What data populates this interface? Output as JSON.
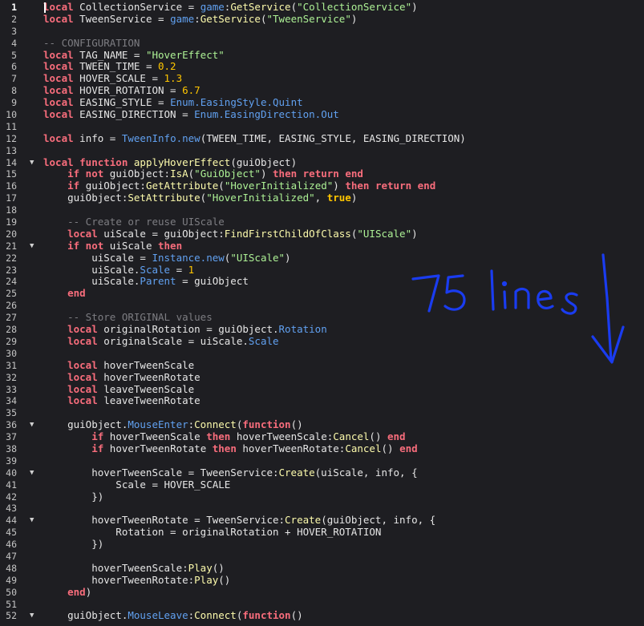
{
  "editor": {
    "cursor_line": 1,
    "lines": [
      {
        "n": "1",
        "fold": false,
        "tokens": [
          {
            "t": "local",
            "c": "kw"
          },
          {
            "t": " CollectionService = ",
            "c": "id"
          },
          {
            "t": "game",
            "c": "prop"
          },
          {
            "t": ":",
            "c": "id"
          },
          {
            "t": "GetService",
            "c": "fn"
          },
          {
            "t": "(",
            "c": "id"
          },
          {
            "t": "\"CollectionService\"",
            "c": "str"
          },
          {
            "t": ")",
            "c": "id"
          }
        ]
      },
      {
        "n": "2",
        "fold": false,
        "tokens": [
          {
            "t": "local",
            "c": "kw"
          },
          {
            "t": " TweenService = ",
            "c": "id"
          },
          {
            "t": "game",
            "c": "prop"
          },
          {
            "t": ":",
            "c": "id"
          },
          {
            "t": "GetService",
            "c": "fn"
          },
          {
            "t": "(",
            "c": "id"
          },
          {
            "t": "\"TweenService\"",
            "c": "str"
          },
          {
            "t": ")",
            "c": "id"
          }
        ]
      },
      {
        "n": "3",
        "fold": false,
        "tokens": []
      },
      {
        "n": "4",
        "fold": false,
        "tokens": [
          {
            "t": "-- CONFIGURATION",
            "c": "cmt"
          }
        ]
      },
      {
        "n": "5",
        "fold": false,
        "tokens": [
          {
            "t": "local",
            "c": "kw"
          },
          {
            "t": " TAG_NAME = ",
            "c": "id"
          },
          {
            "t": "\"HoverEffect\"",
            "c": "str"
          }
        ]
      },
      {
        "n": "6",
        "fold": false,
        "tokens": [
          {
            "t": "local",
            "c": "kw"
          },
          {
            "t": " TWEEN_TIME = ",
            "c": "id"
          },
          {
            "t": "0.2",
            "c": "num"
          }
        ]
      },
      {
        "n": "7",
        "fold": false,
        "tokens": [
          {
            "t": "local",
            "c": "kw"
          },
          {
            "t": " HOVER_SCALE = ",
            "c": "id"
          },
          {
            "t": "1.3",
            "c": "num"
          }
        ]
      },
      {
        "n": "8",
        "fold": false,
        "tokens": [
          {
            "t": "local",
            "c": "kw"
          },
          {
            "t": " HOVER_ROTATION = ",
            "c": "id"
          },
          {
            "t": "6.7",
            "c": "num"
          }
        ]
      },
      {
        "n": "9",
        "fold": false,
        "tokens": [
          {
            "t": "local",
            "c": "kw"
          },
          {
            "t": " EASING_STYLE = ",
            "c": "id"
          },
          {
            "t": "Enum.EasingStyle.Quint",
            "c": "prop"
          }
        ]
      },
      {
        "n": "10",
        "fold": false,
        "tokens": [
          {
            "t": "local",
            "c": "kw"
          },
          {
            "t": " EASING_DIRECTION = ",
            "c": "id"
          },
          {
            "t": "Enum.EasingDirection.Out",
            "c": "prop"
          }
        ]
      },
      {
        "n": "11",
        "fold": false,
        "tokens": []
      },
      {
        "n": "12",
        "fold": false,
        "tokens": [
          {
            "t": "local",
            "c": "kw"
          },
          {
            "t": " info = ",
            "c": "id"
          },
          {
            "t": "TweenInfo.new",
            "c": "prop"
          },
          {
            "t": "(TWEEN_TIME, EASING_STYLE, EASING_DIRECTION)",
            "c": "id"
          }
        ]
      },
      {
        "n": "13",
        "fold": false,
        "tokens": []
      },
      {
        "n": "14",
        "fold": true,
        "tokens": [
          {
            "t": "local function",
            "c": "kw"
          },
          {
            "t": " ",
            "c": "id"
          },
          {
            "t": "applyHoverEffect",
            "c": "fn"
          },
          {
            "t": "(guiObject)",
            "c": "id"
          }
        ]
      },
      {
        "n": "15",
        "fold": false,
        "tokens": [
          {
            "t": "    ",
            "c": "id"
          },
          {
            "t": "if not",
            "c": "kw"
          },
          {
            "t": " guiObject:",
            "c": "id"
          },
          {
            "t": "IsA",
            "c": "fn"
          },
          {
            "t": "(",
            "c": "id"
          },
          {
            "t": "\"GuiObject\"",
            "c": "str"
          },
          {
            "t": ") ",
            "c": "id"
          },
          {
            "t": "then return end",
            "c": "kw"
          }
        ]
      },
      {
        "n": "16",
        "fold": false,
        "tokens": [
          {
            "t": "    ",
            "c": "id"
          },
          {
            "t": "if",
            "c": "kw"
          },
          {
            "t": " guiObject:",
            "c": "id"
          },
          {
            "t": "GetAttribute",
            "c": "fn"
          },
          {
            "t": "(",
            "c": "id"
          },
          {
            "t": "\"HoverInitialized\"",
            "c": "str"
          },
          {
            "t": ") ",
            "c": "id"
          },
          {
            "t": "then return end",
            "c": "kw"
          }
        ]
      },
      {
        "n": "17",
        "fold": false,
        "tokens": [
          {
            "t": "    guiObject:",
            "c": "id"
          },
          {
            "t": "SetAttribute",
            "c": "fn"
          },
          {
            "t": "(",
            "c": "id"
          },
          {
            "t": "\"HoverInitialized\"",
            "c": "str"
          },
          {
            "t": ", ",
            "c": "id"
          },
          {
            "t": "true",
            "c": "bool"
          },
          {
            "t": ")",
            "c": "id"
          }
        ]
      },
      {
        "n": "18",
        "fold": false,
        "tokens": []
      },
      {
        "n": "19",
        "fold": false,
        "tokens": [
          {
            "t": "    ",
            "c": "id"
          },
          {
            "t": "-- Create or reuse UIScale",
            "c": "cmt"
          }
        ]
      },
      {
        "n": "20",
        "fold": false,
        "tokens": [
          {
            "t": "    ",
            "c": "id"
          },
          {
            "t": "local",
            "c": "kw"
          },
          {
            "t": " uiScale = guiObject:",
            "c": "id"
          },
          {
            "t": "FindFirstChildOfClass",
            "c": "fn"
          },
          {
            "t": "(",
            "c": "id"
          },
          {
            "t": "\"UIScale\"",
            "c": "str"
          },
          {
            "t": ")",
            "c": "id"
          }
        ]
      },
      {
        "n": "21",
        "fold": true,
        "tokens": [
          {
            "t": "    ",
            "c": "id"
          },
          {
            "t": "if not",
            "c": "kw"
          },
          {
            "t": " uiScale ",
            "c": "id"
          },
          {
            "t": "then",
            "c": "kw"
          }
        ]
      },
      {
        "n": "22",
        "fold": false,
        "tokens": [
          {
            "t": "        uiScale = ",
            "c": "id"
          },
          {
            "t": "Instance.new",
            "c": "prop"
          },
          {
            "t": "(",
            "c": "id"
          },
          {
            "t": "\"UIScale\"",
            "c": "str"
          },
          {
            "t": ")",
            "c": "id"
          }
        ]
      },
      {
        "n": "23",
        "fold": false,
        "tokens": [
          {
            "t": "        uiScale.",
            "c": "id"
          },
          {
            "t": "Scale",
            "c": "prop"
          },
          {
            "t": " = ",
            "c": "id"
          },
          {
            "t": "1",
            "c": "num"
          }
        ]
      },
      {
        "n": "24",
        "fold": false,
        "tokens": [
          {
            "t": "        uiScale.",
            "c": "id"
          },
          {
            "t": "Parent",
            "c": "prop"
          },
          {
            "t": " = guiObject",
            "c": "id"
          }
        ]
      },
      {
        "n": "25",
        "fold": false,
        "tokens": [
          {
            "t": "    ",
            "c": "id"
          },
          {
            "t": "end",
            "c": "kw"
          }
        ]
      },
      {
        "n": "26",
        "fold": false,
        "tokens": []
      },
      {
        "n": "27",
        "fold": false,
        "tokens": [
          {
            "t": "    ",
            "c": "id"
          },
          {
            "t": "-- Store ORIGINAL values",
            "c": "cmt"
          }
        ]
      },
      {
        "n": "28",
        "fold": false,
        "tokens": [
          {
            "t": "    ",
            "c": "id"
          },
          {
            "t": "local",
            "c": "kw"
          },
          {
            "t": " originalRotation = guiObject.",
            "c": "id"
          },
          {
            "t": "Rotation",
            "c": "prop"
          }
        ]
      },
      {
        "n": "29",
        "fold": false,
        "tokens": [
          {
            "t": "    ",
            "c": "id"
          },
          {
            "t": "local",
            "c": "kw"
          },
          {
            "t": " originalScale = uiScale.",
            "c": "id"
          },
          {
            "t": "Scale",
            "c": "prop"
          }
        ]
      },
      {
        "n": "30",
        "fold": false,
        "tokens": []
      },
      {
        "n": "31",
        "fold": false,
        "tokens": [
          {
            "t": "    ",
            "c": "id"
          },
          {
            "t": "local",
            "c": "kw"
          },
          {
            "t": " hoverTweenScale",
            "c": "id"
          }
        ]
      },
      {
        "n": "32",
        "fold": false,
        "tokens": [
          {
            "t": "    ",
            "c": "id"
          },
          {
            "t": "local",
            "c": "kw"
          },
          {
            "t": " hoverTweenRotate",
            "c": "id"
          }
        ]
      },
      {
        "n": "33",
        "fold": false,
        "tokens": [
          {
            "t": "    ",
            "c": "id"
          },
          {
            "t": "local",
            "c": "kw"
          },
          {
            "t": " leaveTweenScale",
            "c": "id"
          }
        ]
      },
      {
        "n": "34",
        "fold": false,
        "tokens": [
          {
            "t": "    ",
            "c": "id"
          },
          {
            "t": "local",
            "c": "kw"
          },
          {
            "t": " leaveTweenRotate",
            "c": "id"
          }
        ]
      },
      {
        "n": "35",
        "fold": false,
        "tokens": []
      },
      {
        "n": "36",
        "fold": true,
        "tokens": [
          {
            "t": "    guiObject.",
            "c": "id"
          },
          {
            "t": "MouseEnter",
            "c": "prop"
          },
          {
            "t": ":",
            "c": "id"
          },
          {
            "t": "Connect",
            "c": "fn"
          },
          {
            "t": "(",
            "c": "id"
          },
          {
            "t": "function",
            "c": "kw"
          },
          {
            "t": "()",
            "c": "id"
          }
        ]
      },
      {
        "n": "37",
        "fold": false,
        "tokens": [
          {
            "t": "        ",
            "c": "id"
          },
          {
            "t": "if",
            "c": "kw"
          },
          {
            "t": " hoverTweenScale ",
            "c": "id"
          },
          {
            "t": "then",
            "c": "kw"
          },
          {
            "t": " hoverTweenScale:",
            "c": "id"
          },
          {
            "t": "Cancel",
            "c": "fn"
          },
          {
            "t": "() ",
            "c": "id"
          },
          {
            "t": "end",
            "c": "kw"
          }
        ]
      },
      {
        "n": "38",
        "fold": false,
        "tokens": [
          {
            "t": "        ",
            "c": "id"
          },
          {
            "t": "if",
            "c": "kw"
          },
          {
            "t": " hoverTweenRotate ",
            "c": "id"
          },
          {
            "t": "then",
            "c": "kw"
          },
          {
            "t": " hoverTweenRotate:",
            "c": "id"
          },
          {
            "t": "Cancel",
            "c": "fn"
          },
          {
            "t": "() ",
            "c": "id"
          },
          {
            "t": "end",
            "c": "kw"
          }
        ]
      },
      {
        "n": "39",
        "fold": false,
        "tokens": []
      },
      {
        "n": "40",
        "fold": true,
        "tokens": [
          {
            "t": "        hoverTweenScale = TweenService:",
            "c": "id"
          },
          {
            "t": "Create",
            "c": "fn"
          },
          {
            "t": "(uiScale, info, {",
            "c": "id"
          }
        ]
      },
      {
        "n": "41",
        "fold": false,
        "tokens": [
          {
            "t": "            Scale = HOVER_SCALE",
            "c": "id"
          }
        ]
      },
      {
        "n": "42",
        "fold": false,
        "tokens": [
          {
            "t": "        })",
            "c": "id"
          }
        ]
      },
      {
        "n": "43",
        "fold": false,
        "tokens": []
      },
      {
        "n": "44",
        "fold": true,
        "tokens": [
          {
            "t": "        hoverTweenRotate = TweenService:",
            "c": "id"
          },
          {
            "t": "Create",
            "c": "fn"
          },
          {
            "t": "(guiObject, info, {",
            "c": "id"
          }
        ]
      },
      {
        "n": "45",
        "fold": false,
        "tokens": [
          {
            "t": "            Rotation = originalRotation + HOVER_ROTATION",
            "c": "id"
          }
        ]
      },
      {
        "n": "46",
        "fold": false,
        "tokens": [
          {
            "t": "        })",
            "c": "id"
          }
        ]
      },
      {
        "n": "47",
        "fold": false,
        "tokens": []
      },
      {
        "n": "48",
        "fold": false,
        "tokens": [
          {
            "t": "        hoverTweenScale:",
            "c": "id"
          },
          {
            "t": "Play",
            "c": "fn"
          },
          {
            "t": "()",
            "c": "id"
          }
        ]
      },
      {
        "n": "49",
        "fold": false,
        "tokens": [
          {
            "t": "        hoverTweenRotate:",
            "c": "id"
          },
          {
            "t": "Play",
            "c": "fn"
          },
          {
            "t": "()",
            "c": "id"
          }
        ]
      },
      {
        "n": "50",
        "fold": false,
        "tokens": [
          {
            "t": "    ",
            "c": "id"
          },
          {
            "t": "end",
            "c": "kw"
          },
          {
            "t": ")",
            "c": "id"
          }
        ]
      },
      {
        "n": "51",
        "fold": false,
        "tokens": []
      },
      {
        "n": "52",
        "fold": true,
        "tokens": [
          {
            "t": "    guiObject.",
            "c": "id"
          },
          {
            "t": "MouseLeave",
            "c": "prop"
          },
          {
            "t": ":",
            "c": "id"
          },
          {
            "t": "Connect",
            "c": "fn"
          },
          {
            "t": "(",
            "c": "id"
          },
          {
            "t": "function",
            "c": "kw"
          },
          {
            "t": "()",
            "c": "id"
          }
        ]
      }
    ]
  },
  "annotation": {
    "text": "75 lines",
    "color": "#1a3cf0",
    "icon": "arrow-down-icon"
  },
  "colors": {
    "background": "#1e1e22",
    "keyword": "#f86d7c",
    "string": "#adf195",
    "number": "#ffc600",
    "comment": "#7d7d82",
    "function": "#fdfbac",
    "property": "#61a1f1",
    "text": "#e6e6e6"
  }
}
